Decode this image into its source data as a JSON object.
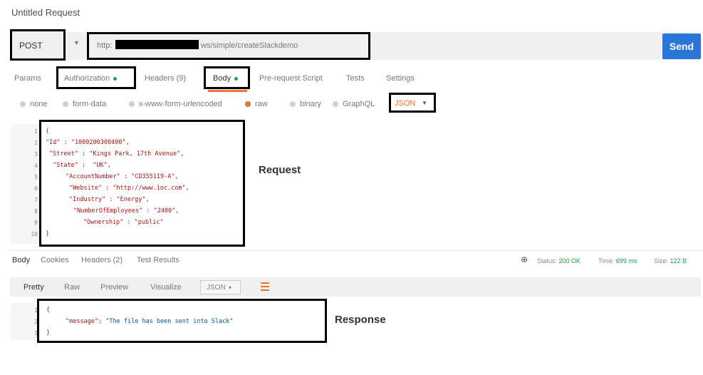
{
  "title": "Untitled Request",
  "request": {
    "method": "POST",
    "url_prefix": "http:",
    "url_suffix": "ws/simple/createSlackdemo",
    "send_label": "Send"
  },
  "request_tabs": {
    "params": "Params",
    "authorization": "Authorization",
    "headers": "Headers (9)",
    "body": "Body",
    "prerequest": "Pre-request Script",
    "tests": "Tests",
    "settings": "Settings"
  },
  "body_types": {
    "none": "none",
    "formdata": "form-data",
    "urlencoded": "x-www-form-urlencoded",
    "raw": "raw",
    "binary": "binary",
    "graphql": "GraphQL",
    "selected_format": "JSON"
  },
  "request_body": {
    "line_numbers": [
      "1",
      "2",
      "3",
      "4",
      "5",
      "6",
      "7",
      "8",
      "9",
      "10"
    ],
    "lines": [
      "{",
      "\"Id\" : \"1000200300400\",",
      "\"Street\" : \"Kings Park, 17th Avenue\",",
      "\"State\" :  \"UK\",",
      "\"AccountNumber\" : \"CD355119-A\",",
      "\"Website\" : \"http://www.ioc.com\",",
      "\"Industry\" : \"Energy\",",
      "\"NumberOfEmployees\" : \"2400\",",
      "\"Ownership\" : \"public\"",
      "}"
    ],
    "annotation": "Request"
  },
  "response_tabs": {
    "body": "Body",
    "cookies": "Cookies",
    "headers": "Headers (2)",
    "test_results": "Test Results"
  },
  "status": {
    "status_label": "Status:",
    "status_value": "200 OK",
    "time_label": "Time:",
    "time_value": "699 ms",
    "size_label": "Size:",
    "size_value": "122 B"
  },
  "response_toolbar": {
    "pretty": "Pretty",
    "raw": "Raw",
    "preview": "Preview",
    "visualize": "Visualize",
    "format": "JSON"
  },
  "response_body": {
    "line_numbers": [
      "1",
      "2",
      "3"
    ],
    "open": "{",
    "message_key": "\"message\":",
    "message_value": " \"The file has been sent into Slack\"",
    "close": "}",
    "annotation": "Response"
  },
  "colors": {
    "accent": "#e8742f",
    "send": "#2a75d8",
    "active_dot": "#1e9e4a"
  }
}
